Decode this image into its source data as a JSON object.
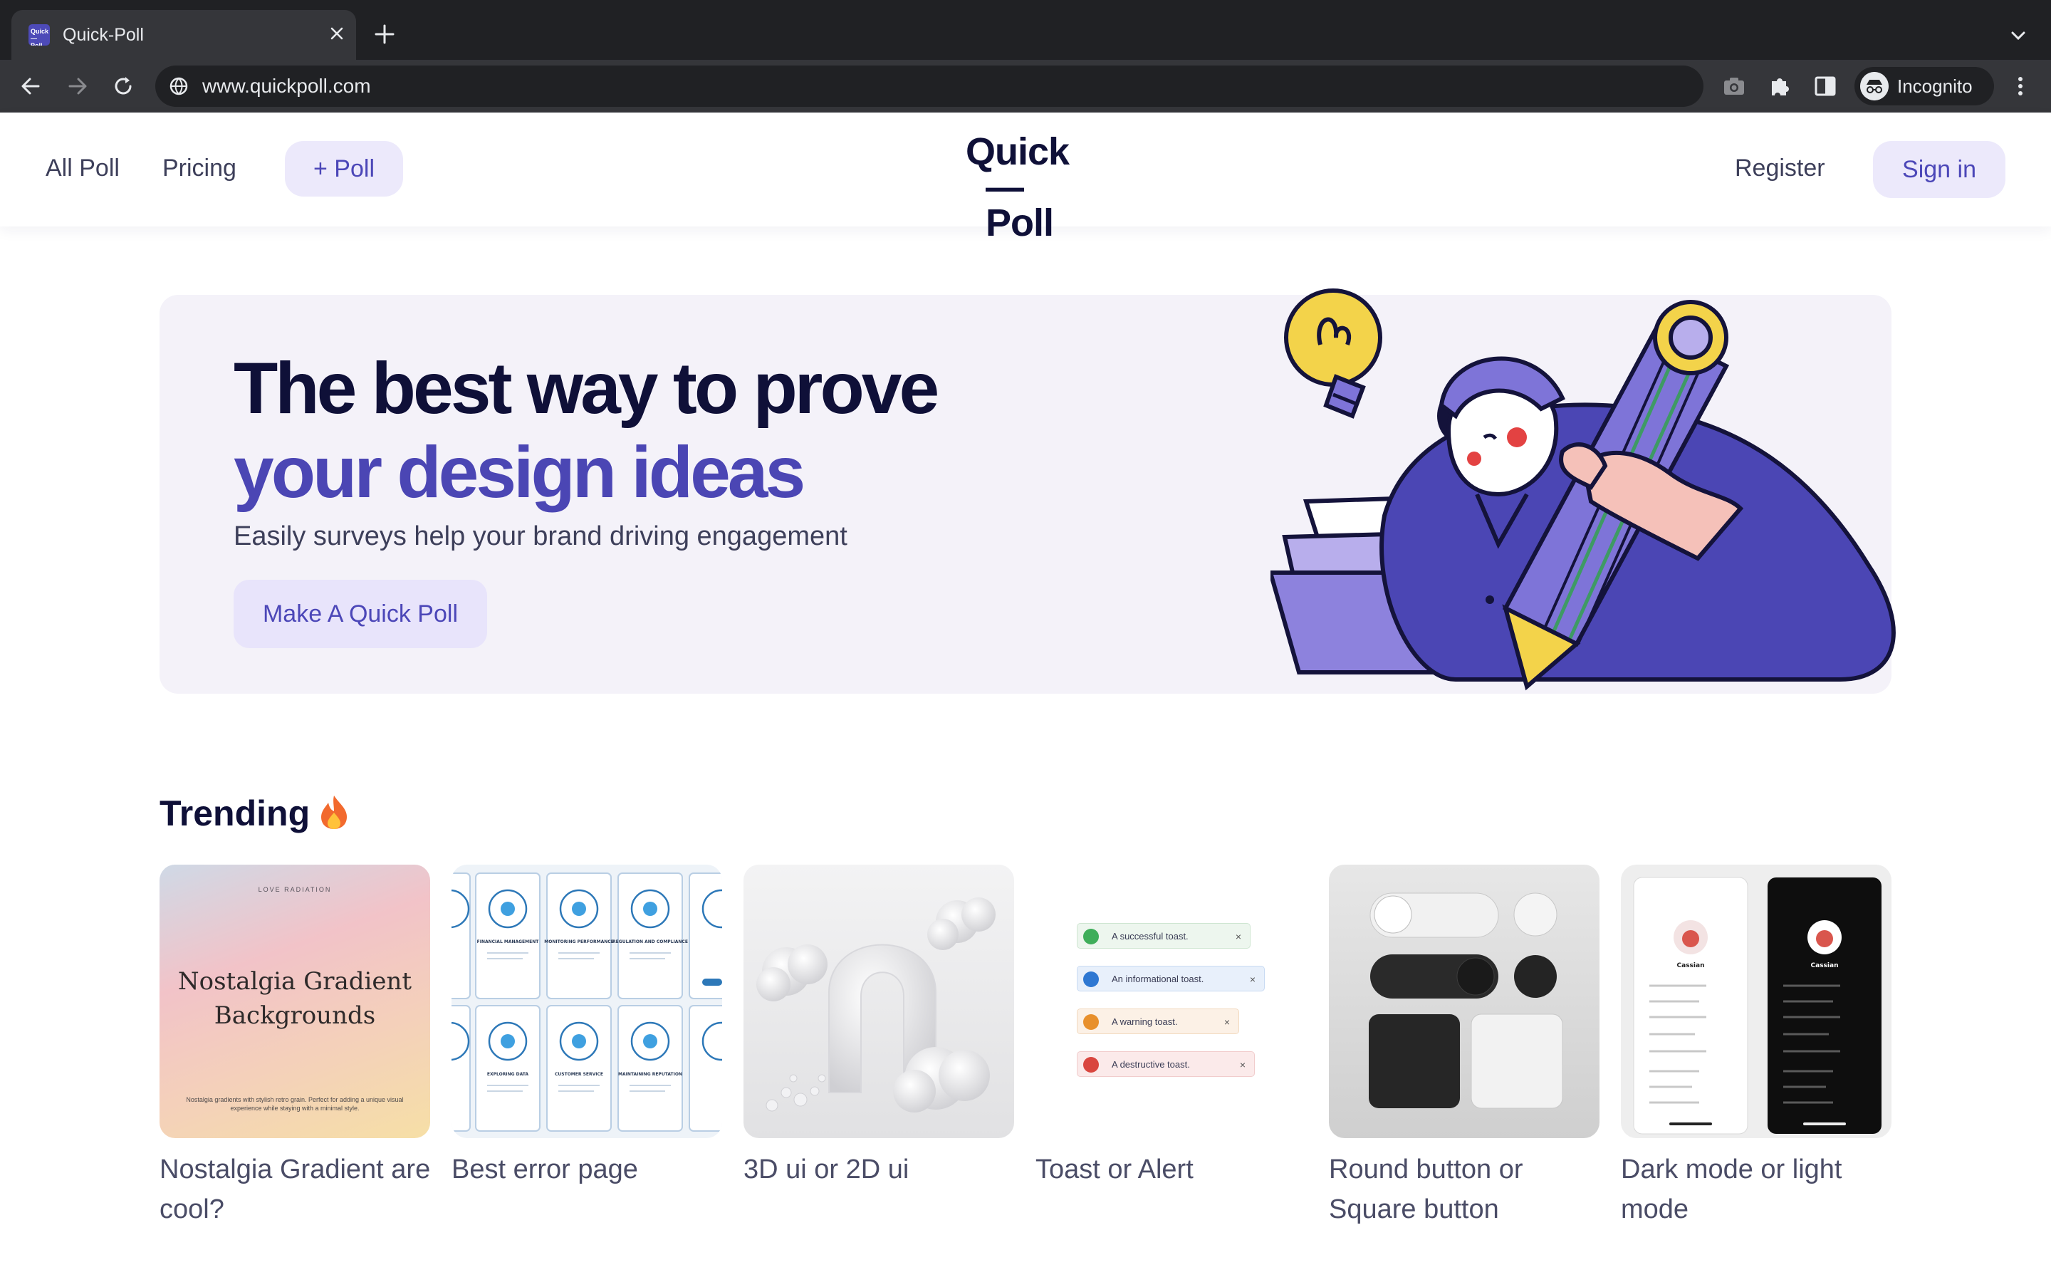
{
  "browser": {
    "tab_title": "Quick-Poll",
    "favicon_text": "Quick —Poll",
    "url": "www.quickpoll.com",
    "incognito_label": "Incognito",
    "icons": [
      "back-arrow-icon",
      "forward-arrow-icon",
      "reload-icon",
      "site-info-icon",
      "camera-icon",
      "extensions-puzzle-icon",
      "side-panel-icon",
      "kebab-menu-icon",
      "tab-search-chevron-icon"
    ],
    "colors": {
      "tabstrip": "#202124",
      "toolbar": "#35363a"
    }
  },
  "header": {
    "nav": [
      "All Poll",
      "Pricing"
    ],
    "new_poll_label": "+ Poll",
    "logo_line1": "Quick",
    "logo_line2": "—Poll",
    "register_label": "Register",
    "signin_label": "Sign in"
  },
  "hero": {
    "title_line1": "The best way to prove",
    "title_line2": "your design ideas",
    "subtitle": "Easily surveys help your brand driving engagement",
    "cta_label": "Make A Quick Poll",
    "accent_color": "#4b46b4"
  },
  "trending": {
    "title": "Trending",
    "title_icon": "fire-icon",
    "polls": [
      {
        "label": "Nostalgia Gradient are cool?",
        "thumb_top": "LOVE RADIATION",
        "thumb_main": "Nostalgia Gradient Backgrounds",
        "thumb_small": "Nostalgia gradients with stylish retro grain. Perfect for adding a unique visual experience while staying with a minimal style."
      },
      {
        "label": "Best error page",
        "thumb_labels": [
          "FINANCIAL MANAGEMENT",
          "MONITORING PERFORMANCE",
          "REGULATION AND COMPLIANCE",
          "EXPLORING DATA",
          "CUSTOMER SERVICE",
          "MAINTAINING REPUTATION"
        ]
      },
      {
        "label": "3D ui or 2D ui"
      },
      {
        "label": "Toast or Alert",
        "toasts": [
          "A successful toast.",
          "An informational toast.",
          "A warning toast.",
          "A destructive toast."
        ]
      },
      {
        "label": "Round button or Square button"
      },
      {
        "label": "Dark mode or light mode",
        "profile_name": "Cassian"
      }
    ]
  }
}
